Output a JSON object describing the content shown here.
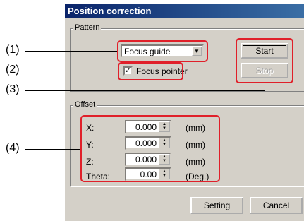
{
  "window": {
    "title": "Position correction"
  },
  "pattern": {
    "group_label": "Pattern",
    "combo_value": "Focus guide",
    "checkbox_label": "Focus pointer",
    "checkbox_checked": true,
    "start_label": "Start",
    "stop_label": "Stop"
  },
  "offset": {
    "group_label": "Offset",
    "rows": [
      {
        "label": "X:",
        "value": "0.000",
        "unit": "(mm)"
      },
      {
        "label": "Y:",
        "value": "0.000",
        "unit": "(mm)"
      },
      {
        "label": "Z:",
        "value": "0.000",
        "unit": "(mm)"
      },
      {
        "label": "Theta:",
        "value": "0.00",
        "unit": "(Deg.)"
      }
    ]
  },
  "footer": {
    "setting_label": "Setting",
    "cancel_label": "Cancel"
  },
  "callouts": [
    "(1)",
    "(2)",
    "(3)",
    "(4)"
  ],
  "colors": {
    "highlight": "#e0202a",
    "dialog_bg": "#d4d0c8",
    "title_bar": "#0a246a"
  }
}
